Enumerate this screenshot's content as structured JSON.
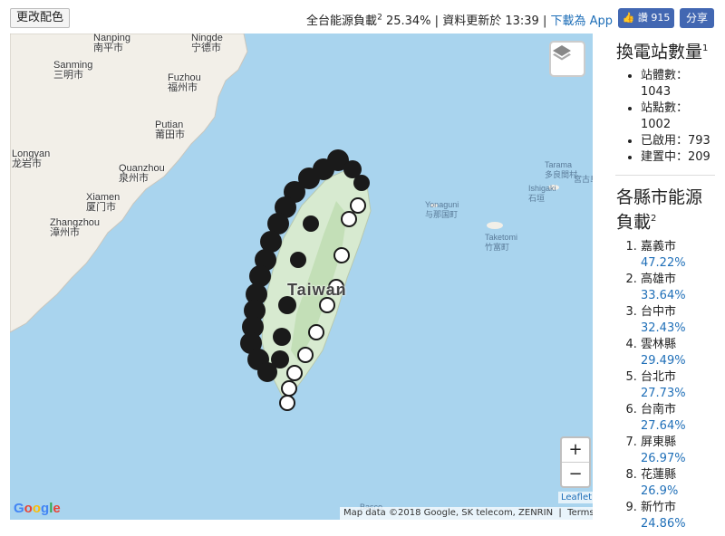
{
  "topbar": {
    "recolor_label": "更改配色",
    "load_label": "全台能源負載",
    "load_sup": "2",
    "load_value": "25.34%",
    "sep1": "|",
    "updated_label": "資料更新於 13:39",
    "sep2": "|",
    "download_label": "下載為 App",
    "like_label": "讚 915",
    "share_label": "分享"
  },
  "map": {
    "labels": {
      "nanping": "Nanping",
      "nanping_zh": "南平市",
      "ningde": "Ningde",
      "ningde_zh": "宁德市",
      "sanming": "Sanming",
      "sanming_zh": "三明市",
      "fuzhou": "Fuzhou",
      "fuzhou_zh": "福州市",
      "putian": "Putian",
      "putian_zh": "莆田市",
      "longyan": "Longyan",
      "longyan_zh": "龙岩市",
      "quanzhou": "Quanzhou",
      "quanzhou_zh": "泉州市",
      "xiamen": "Xiamen",
      "xiamen_zh": "厦门市",
      "zhangzhou": "Zhangzhou",
      "zhangzhou_zh": "漳州市",
      "taiwan": "Taiwan",
      "yonaguni": "Yonaguni",
      "yonaguni_zh": "与那国町",
      "ishigaki": "Ishigaki",
      "ishigaki_zh": "石垣",
      "tarama": "Tarama",
      "tarama_zh": "多良間村",
      "miyako": "宮古島市",
      "taketomi": "Taketomi",
      "taketomi_zh": "竹富町",
      "basco": "Basco"
    },
    "leaflet_label": "Leaflet",
    "google_label": "Google",
    "attribution": "Map data ©2018 Google, SK telecom, ZENRIN",
    "terms_label": "Terms of Use",
    "zoom_in": "+",
    "zoom_out": "−"
  },
  "sidebar": {
    "stations_title": "換電站數量",
    "stations_sup": "1",
    "stats": [
      {
        "label": "站體數：",
        "value": "1043"
      },
      {
        "label": "站點數：",
        "value": "1002"
      },
      {
        "label": "已啟用：",
        "value": "793"
      },
      {
        "label": "建置中：",
        "value": "209"
      }
    ],
    "county_title": "各縣市能源負載",
    "county_sup": "2",
    "counties": [
      {
        "name": "嘉義市",
        "pct": "47.22%"
      },
      {
        "name": "高雄市",
        "pct": "33.64%"
      },
      {
        "name": "台中市",
        "pct": "32.43%"
      },
      {
        "name": "雲林縣",
        "pct": "29.49%"
      },
      {
        "name": "台北市",
        "pct": "27.73%"
      },
      {
        "name": "台南市",
        "pct": "27.64%"
      },
      {
        "name": "屏東縣",
        "pct": "26.97%"
      },
      {
        "name": "花蓮縣",
        "pct": "26.9%"
      },
      {
        "name": "新竹市",
        "pct": "24.86%"
      }
    ]
  }
}
